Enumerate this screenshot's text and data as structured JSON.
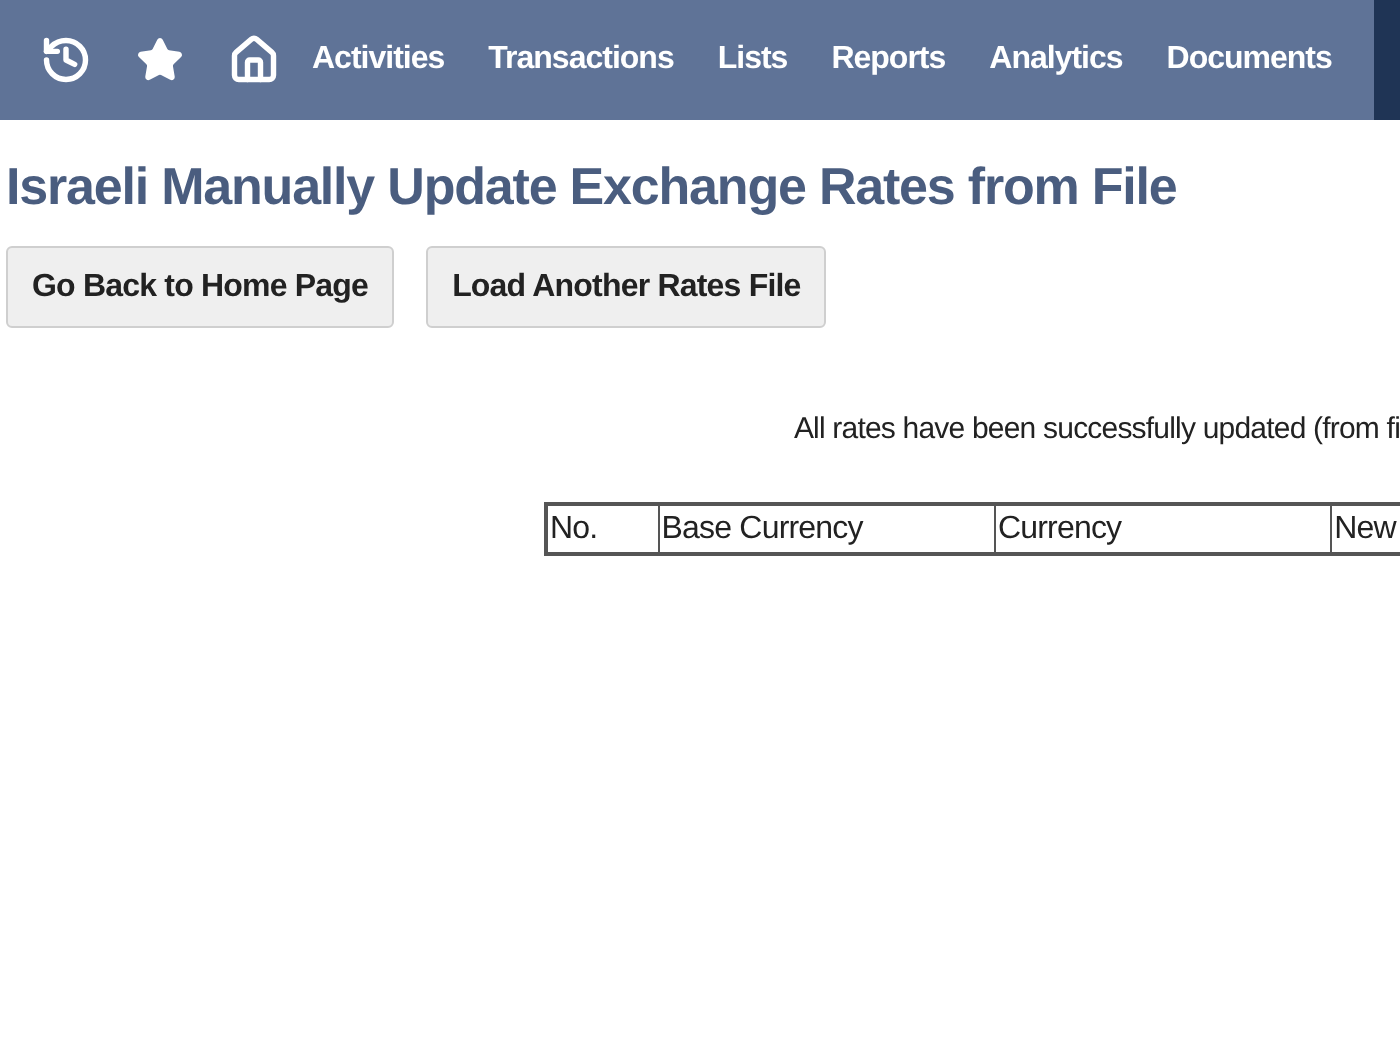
{
  "nav": {
    "items": [
      {
        "label": "Activities"
      },
      {
        "label": "Transactions"
      },
      {
        "label": "Lists"
      },
      {
        "label": "Reports"
      },
      {
        "label": "Analytics"
      },
      {
        "label": "Documents"
      }
    ]
  },
  "page_title": "Israeli Manually Update Exchange Rates from File",
  "buttons": [
    "Go Back to Home Page",
    "Load Another Rates File"
  ],
  "message": "All rates have been successfully updated (from fi",
  "table": {
    "columns": [
      "No.",
      "Base Currency",
      "Currency",
      "New"
    ]
  }
}
